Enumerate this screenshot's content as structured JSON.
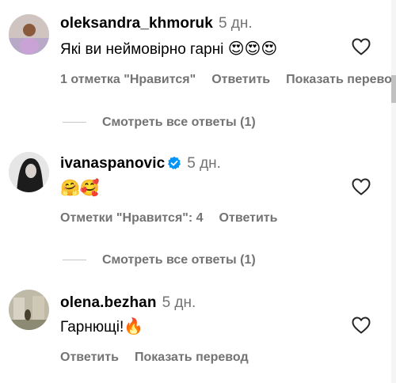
{
  "comments": [
    {
      "username": "oleksandra_khmoruk",
      "time": "5 дн.",
      "text": "Які ви неймовірно гарні ",
      "emoji": "😍😍😍",
      "likes_label": "1 отметка \"Нравится\"",
      "reply_label": "Ответить",
      "translate_label": "Показать перевод",
      "view_replies": "Смотреть все ответы (1)"
    },
    {
      "username": "ivanaspanovic",
      "time": "5 дн.",
      "text": "",
      "emoji": "🤗🥰",
      "likes_label": "Отметки \"Нравится\": 4",
      "reply_label": "Ответить",
      "view_replies": "Смотреть все ответы (1)"
    },
    {
      "username": "olena.bezhan",
      "time": "5 дн.",
      "text": "Гарнющі!",
      "emoji": "🔥",
      "reply_label": "Ответить",
      "translate_label": "Показать перевод"
    }
  ],
  "icons": {
    "like": "heart-outline-icon",
    "verified": "verified-badge-icon"
  },
  "colors": {
    "verified": "#0095f6",
    "secondary_text": "#737373"
  }
}
